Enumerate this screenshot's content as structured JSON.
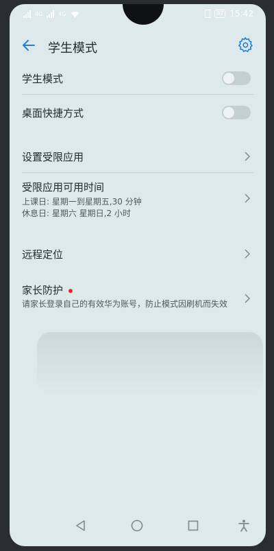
{
  "status_bar": {
    "signal_1": "4G",
    "signal_2": "4G",
    "battery": "87",
    "time": "15:42"
  },
  "header": {
    "title": "学生模式"
  },
  "items": {
    "student_mode": {
      "label": "学生模式",
      "toggle": "off"
    },
    "desktop_shortcut": {
      "label": "桌面快捷方式",
      "toggle": "off"
    },
    "restricted_apps": {
      "label": "设置受限应用"
    },
    "available_time": {
      "label": "受限应用可用时间",
      "school_days": "上课日: 星期一到星期五,30 分钟",
      "rest_days": "休息日: 星期六 星期日,2 小时"
    },
    "remote_location": {
      "label": "远程定位"
    },
    "parent_protection": {
      "label": "家长防护",
      "description": "请家长登录自己的有效华为账号，防止模式因刷机而失效"
    }
  },
  "icons": {
    "back": "arrow-left-icon",
    "settings": "gear-icon",
    "nav_back": "triangle-back-icon",
    "nav_home": "circle-home-icon",
    "nav_recent": "square-recent-icon",
    "accessibility": "accessibility-icon"
  },
  "colors": {
    "accent": "#1f7fd6",
    "background": "#dde9eb",
    "badge": "#e02a2a"
  }
}
